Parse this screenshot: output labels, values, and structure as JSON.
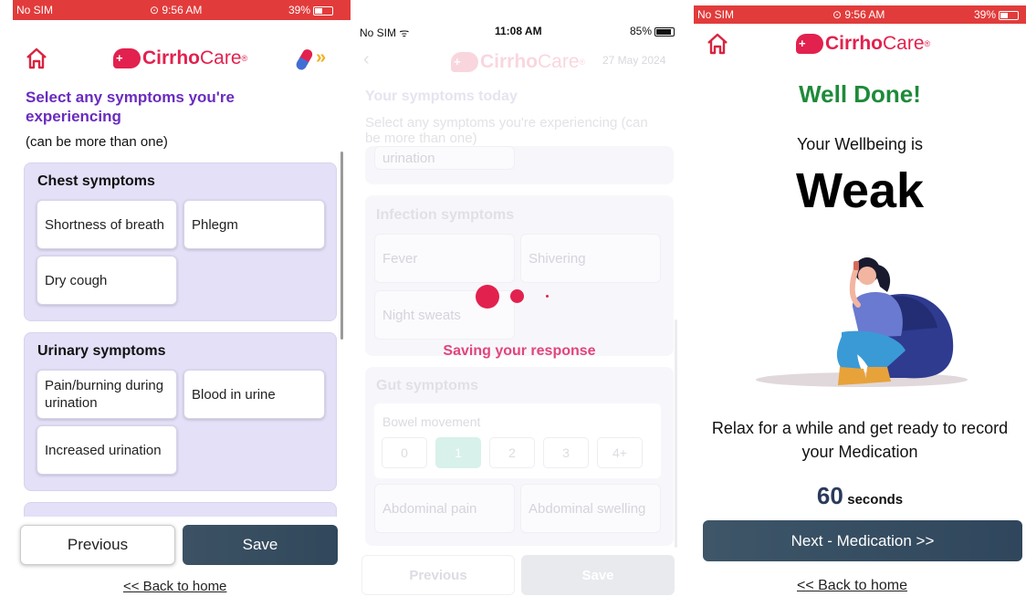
{
  "screen1": {
    "status": {
      "carrier": "No SIM",
      "time": "9:56 AM",
      "battery": "39%"
    },
    "brand": {
      "name_bold": "Cirrho",
      "name_light": "Care",
      "mark": "®"
    },
    "heading": "Select any symptoms you're experiencing",
    "subheading": "(can be more than one)",
    "groups": [
      {
        "title": "Chest symptoms",
        "items": [
          "Shortness of breath",
          "Phlegm",
          "Dry cough"
        ]
      },
      {
        "title": "Urinary symptoms",
        "items": [
          "Pain/burning during urination",
          "Blood in urine",
          "Increased urination"
        ]
      }
    ],
    "previous_label": "Previous",
    "save_label": "Save",
    "back_home": "<< Back to home",
    "colors": {
      "status_bar": "#e23b3b",
      "heading": "#6a2bbf",
      "group_bg": "#e3e0f7",
      "save_btn": "#3a5064"
    }
  },
  "screen2": {
    "status": {
      "carrier": "No SIM",
      "time": "11:08 AM",
      "battery": "85%"
    },
    "brand": {
      "name_bold": "Cirrho",
      "name_light": "Care",
      "mark": "®"
    },
    "date": "27 May 2024",
    "title": "Your symptoms today",
    "subtitle": "Select any symptoms you're experiencing (can be more than one)",
    "partial_item": "urination",
    "infection": {
      "title": "Infection symptoms",
      "items": [
        "Fever",
        "Shivering",
        "Night sweats"
      ]
    },
    "saving_text": "Saving your response",
    "gut": {
      "title": "Gut symptoms",
      "bowel_label": "Bowel movement",
      "options": [
        "0",
        "1",
        "2",
        "3",
        "4+"
      ],
      "selected": "1",
      "items": [
        "Abdominal pain",
        "Abdominal swelling"
      ]
    },
    "previous_label": "Previous",
    "save_label": "Save",
    "colors": {
      "saving": "#e2457a",
      "dots": "#e2214e"
    }
  },
  "screen3": {
    "status": {
      "carrier": "No SIM",
      "time": "9:56 AM",
      "battery": "39%"
    },
    "brand": {
      "name_bold": "Cirrho",
      "name_light": "Care",
      "mark": "®"
    },
    "well_done": "Well Done!",
    "wellbeing_label": "Your Wellbeing is",
    "wellbeing_value": "Weak",
    "relax_text": "Relax for a while and get ready to record your Medication",
    "timer_value": "60",
    "timer_unit": "seconds",
    "next_label": "Next - Medication >>",
    "back_home": "<< Back to home",
    "colors": {
      "well_done": "#1f8a3a",
      "next_btn": "#3a5468"
    }
  }
}
